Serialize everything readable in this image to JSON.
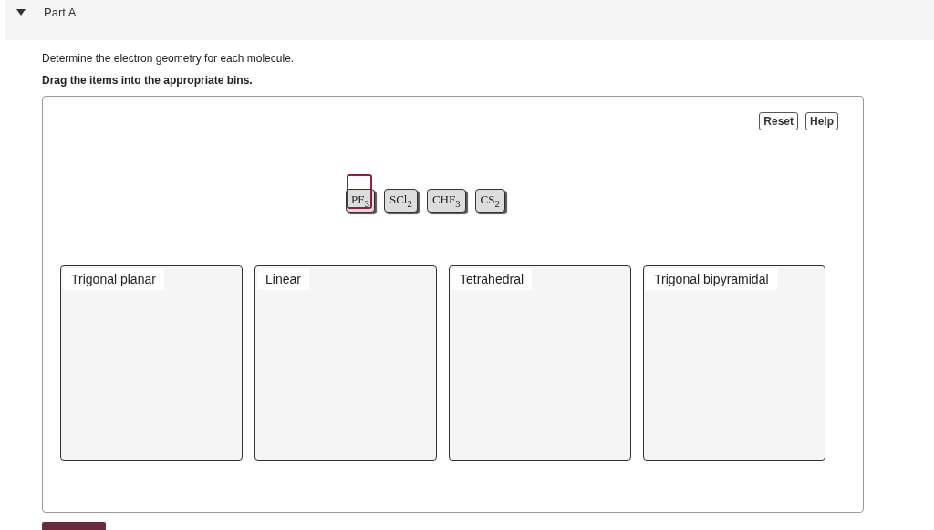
{
  "part": {
    "title": "Part A",
    "expanded": true
  },
  "instructions": "Determine the electron geometry for each molecule.",
  "task": "Drag the items into the appropriate bins.",
  "buttons": [
    "Reset",
    "Help"
  ],
  "items": [
    {
      "label": "PF$_{3}$",
      "focused": true
    },
    {
      "label": "SCl$_{2}$",
      "focused": false
    },
    {
      "label": "CHF$_{3}$",
      "focused": false
    },
    {
      "label": "CS$_{2}$",
      "focused": false
    }
  ],
  "bins": [
    {
      "label": "Trigonal planar"
    },
    {
      "label": "Linear"
    },
    {
      "label": "Tetrahedral"
    },
    {
      "label": "Trigonal bipyramidal"
    }
  ]
}
